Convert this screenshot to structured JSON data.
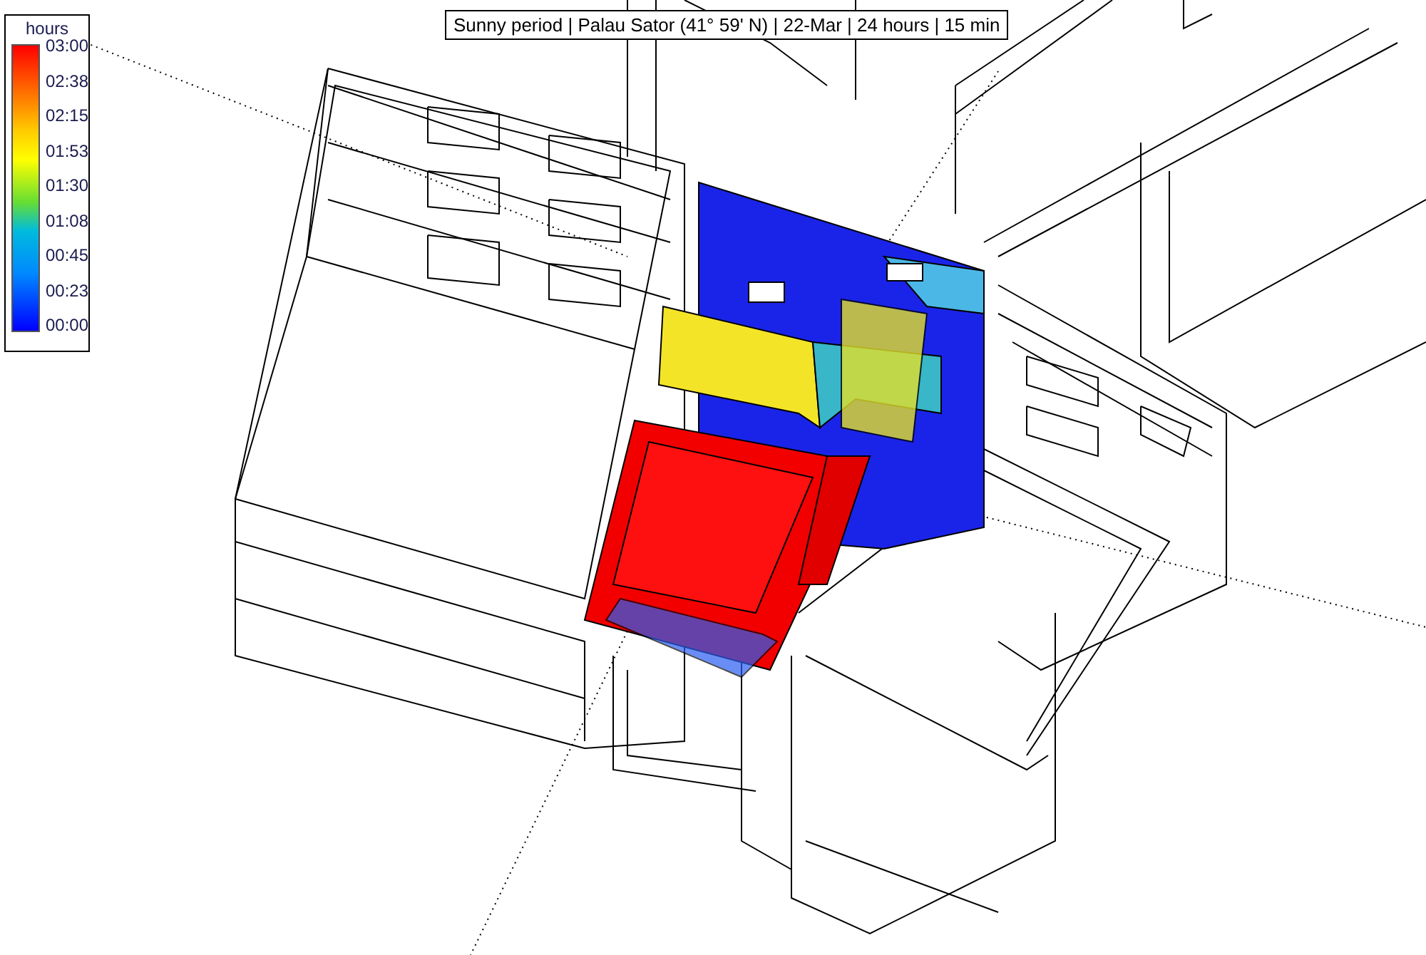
{
  "title": "Sunny period | Palau Sator (41° 59' N) | 22-Mar | 24 hours | 15 min",
  "legend": {
    "unit": "hours",
    "ticks": [
      "03:00",
      "02:38",
      "02:15",
      "01:53",
      "01:30",
      "01:08",
      "00:45",
      "00:23",
      "00:00"
    ]
  }
}
